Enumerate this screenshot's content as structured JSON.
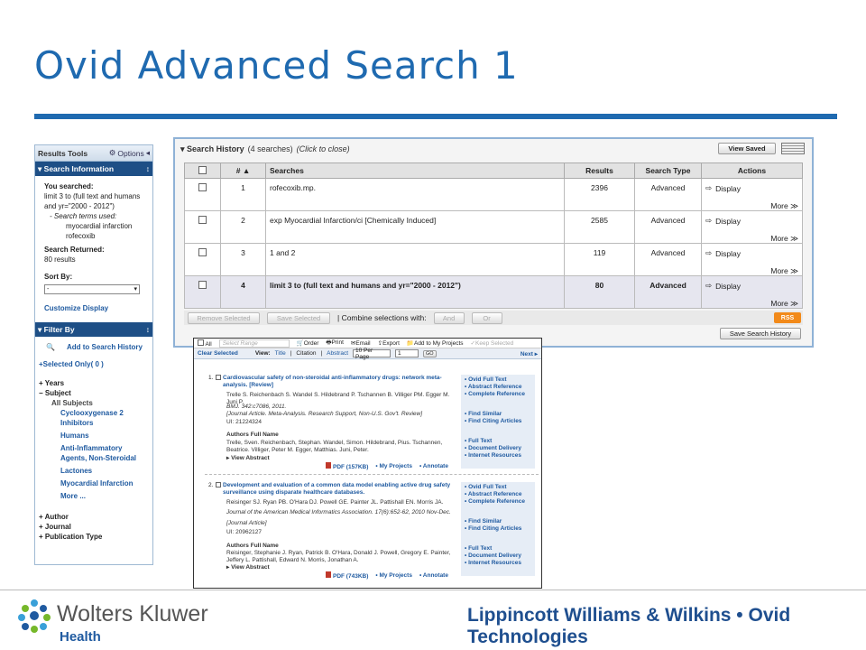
{
  "slide": {
    "title": "Ovid Advanced Search 1"
  },
  "left_panel": {
    "header": "Results Tools",
    "options_label": "Options",
    "search_info_title": "Search Information",
    "you_searched_label": "You searched:",
    "you_searched_value_1": "limit 3 to (full text and humans",
    "you_searched_value_2": "and yr=\"2000 - 2012\")",
    "terms_used_label": "- Search terms used:",
    "terms": [
      "myocardial infarction",
      "rofecoxib"
    ],
    "returned_label": "Search Returned:",
    "returned_value": "80 results",
    "sort_by_label": "Sort By:",
    "sort_by_value": "-",
    "customize_label": "Customize Display",
    "filter_title": "Filter By",
    "add_history_label": "Add to Search History",
    "selected_only_label": "+Selected Only( 0 )",
    "years_label": "Years",
    "subject_label": "Subject",
    "all_subjects_label": "All Subjects",
    "subjects": [
      "Cyclooxygenase 2 Inhibitors",
      "Humans",
      "Anti-Inflammatory Agents, Non-Steroidal",
      "Lactones",
      "Myocardial Infarction",
      "More ..."
    ],
    "other_filters": [
      "Author",
      "Journal",
      "Publication Type"
    ]
  },
  "search_history": {
    "title": "Search History",
    "count": "(4 searches)",
    "hint": "(Click to close)",
    "view_saved_label": "View Saved",
    "columns": {
      "num": "# ▲",
      "searches": "Searches",
      "results": "Results",
      "type": "Search Type",
      "actions": "Actions"
    },
    "rows": [
      {
        "num": "1",
        "query": "rofecoxib.mp.",
        "results": "2396",
        "type": "Advanced"
      },
      {
        "num": "2",
        "query": "exp Myocardial Infarction/ci [Chemically Induced]",
        "results": "2585",
        "type": "Advanced"
      },
      {
        "num": "3",
        "query": "1 and 2",
        "results": "119",
        "type": "Advanced"
      },
      {
        "num": "4",
        "query": "limit 3 to (full text and humans and yr=\"2000 - 2012\")",
        "results": "80",
        "type": "Advanced"
      }
    ],
    "display_label": "Display",
    "more_label": "More ≫",
    "remove_selected": "Remove Selected",
    "save_selected": "Save Selected",
    "combine_label": "| Combine selections with:",
    "and_label": "And",
    "or_label": "Or",
    "rss_label": "RSS",
    "save_history_label": "Save Search History"
  },
  "results": {
    "all_label": "All",
    "range_placeholder": "Select Range",
    "order_label": "Order",
    "print_label": "Print",
    "email_label": "Email",
    "export_label": "Export",
    "add_projects_label": "Add to My Projects",
    "keep_selected_label": "Keep Selected",
    "clear_selected_label": "Clear Selected",
    "view_label": "View:",
    "view_title": "Title",
    "view_citation": "Citation",
    "view_abstract": "Abstract",
    "per_page": "10 Per Page",
    "page_value": "1",
    "go_label": "GO",
    "next_label": "Next ▸",
    "records": [
      {
        "num": "1.",
        "title": "Cardiovascular safety of non-steroidal anti-inflammatory drugs: network meta-analysis. [Review]",
        "authors": "Trelle S. Reichenbach S. Wandel S. Hildebrand P. Tschannen B. Villiger PM. Egger M. Juni P.",
        "journal": "BMJ. 342:c7086, 2011.",
        "pubtype": "[Journal Article. Meta-Analysis. Research Support, Non-U.S. Gov't. Review]",
        "ui": "UI: 21224324",
        "full_name_label": "Authors Full Name",
        "full_names": "Trelle, Sven. Reichenbach, Stephan. Wandel, Simon. Hildebrand, Pius. Tschannen, Beatrice. Villiger, Peter M. Egger, Matthias. Juni, Peter.",
        "view_abstract": "▸ View Abstract",
        "pdf": "PDF (157KB)",
        "links": [
          "• Ovid Full Text",
          "• Abstract Reference",
          "• Complete Reference",
          "",
          "• Find Similar",
          "• Find Citing Articles",
          "",
          "• Full Text",
          "• Document Delivery",
          "• Internet Resources"
        ]
      },
      {
        "num": "2.",
        "title": "Development and evaluation of a common data model enabling active drug safety surveillance using disparate healthcare databases.",
        "authors": "Reisinger SJ. Ryan PB. O'Hara DJ. Powell GE. Painter JL. Pattishall EN. Morris JA.",
        "journal": "Journal of the American Medical Informatics Association. 17(6):652-62, 2010 Nov-Dec.",
        "pubtype": "[Journal Article]",
        "ui": "UI: 20962127",
        "full_name_label": "Authors Full Name",
        "full_names": "Reisinger, Stephanie J. Ryan, Patrick B. O'Hara, Donald J. Powell, Gregory E. Painter, Jeffery L. Pattishall, Edward N. Morris, Jonathan A.",
        "view_abstract": "▸ View Abstract",
        "pdf": "PDF (743KB)",
        "links": [
          "• Ovid Full Text",
          "• Abstract Reference",
          "• Complete Reference",
          "",
          "• Find Similar",
          "• Find Citing Articles",
          "",
          "• Full Text",
          "• Document Delivery",
          "• Internet Resources"
        ]
      }
    ],
    "my_projects_label": "• My Projects",
    "annotate_label": "• Annotate"
  },
  "footer": {
    "brand_name": "Wolters Kluwer",
    "brand_sub": "Health",
    "right_text": "Lippincott Williams & Wilkins • Ovid Technologies"
  },
  "colors": {
    "primary": "#1f6ab0",
    "nav_dark": "#1e4f86",
    "rss": "#f28a1a"
  }
}
